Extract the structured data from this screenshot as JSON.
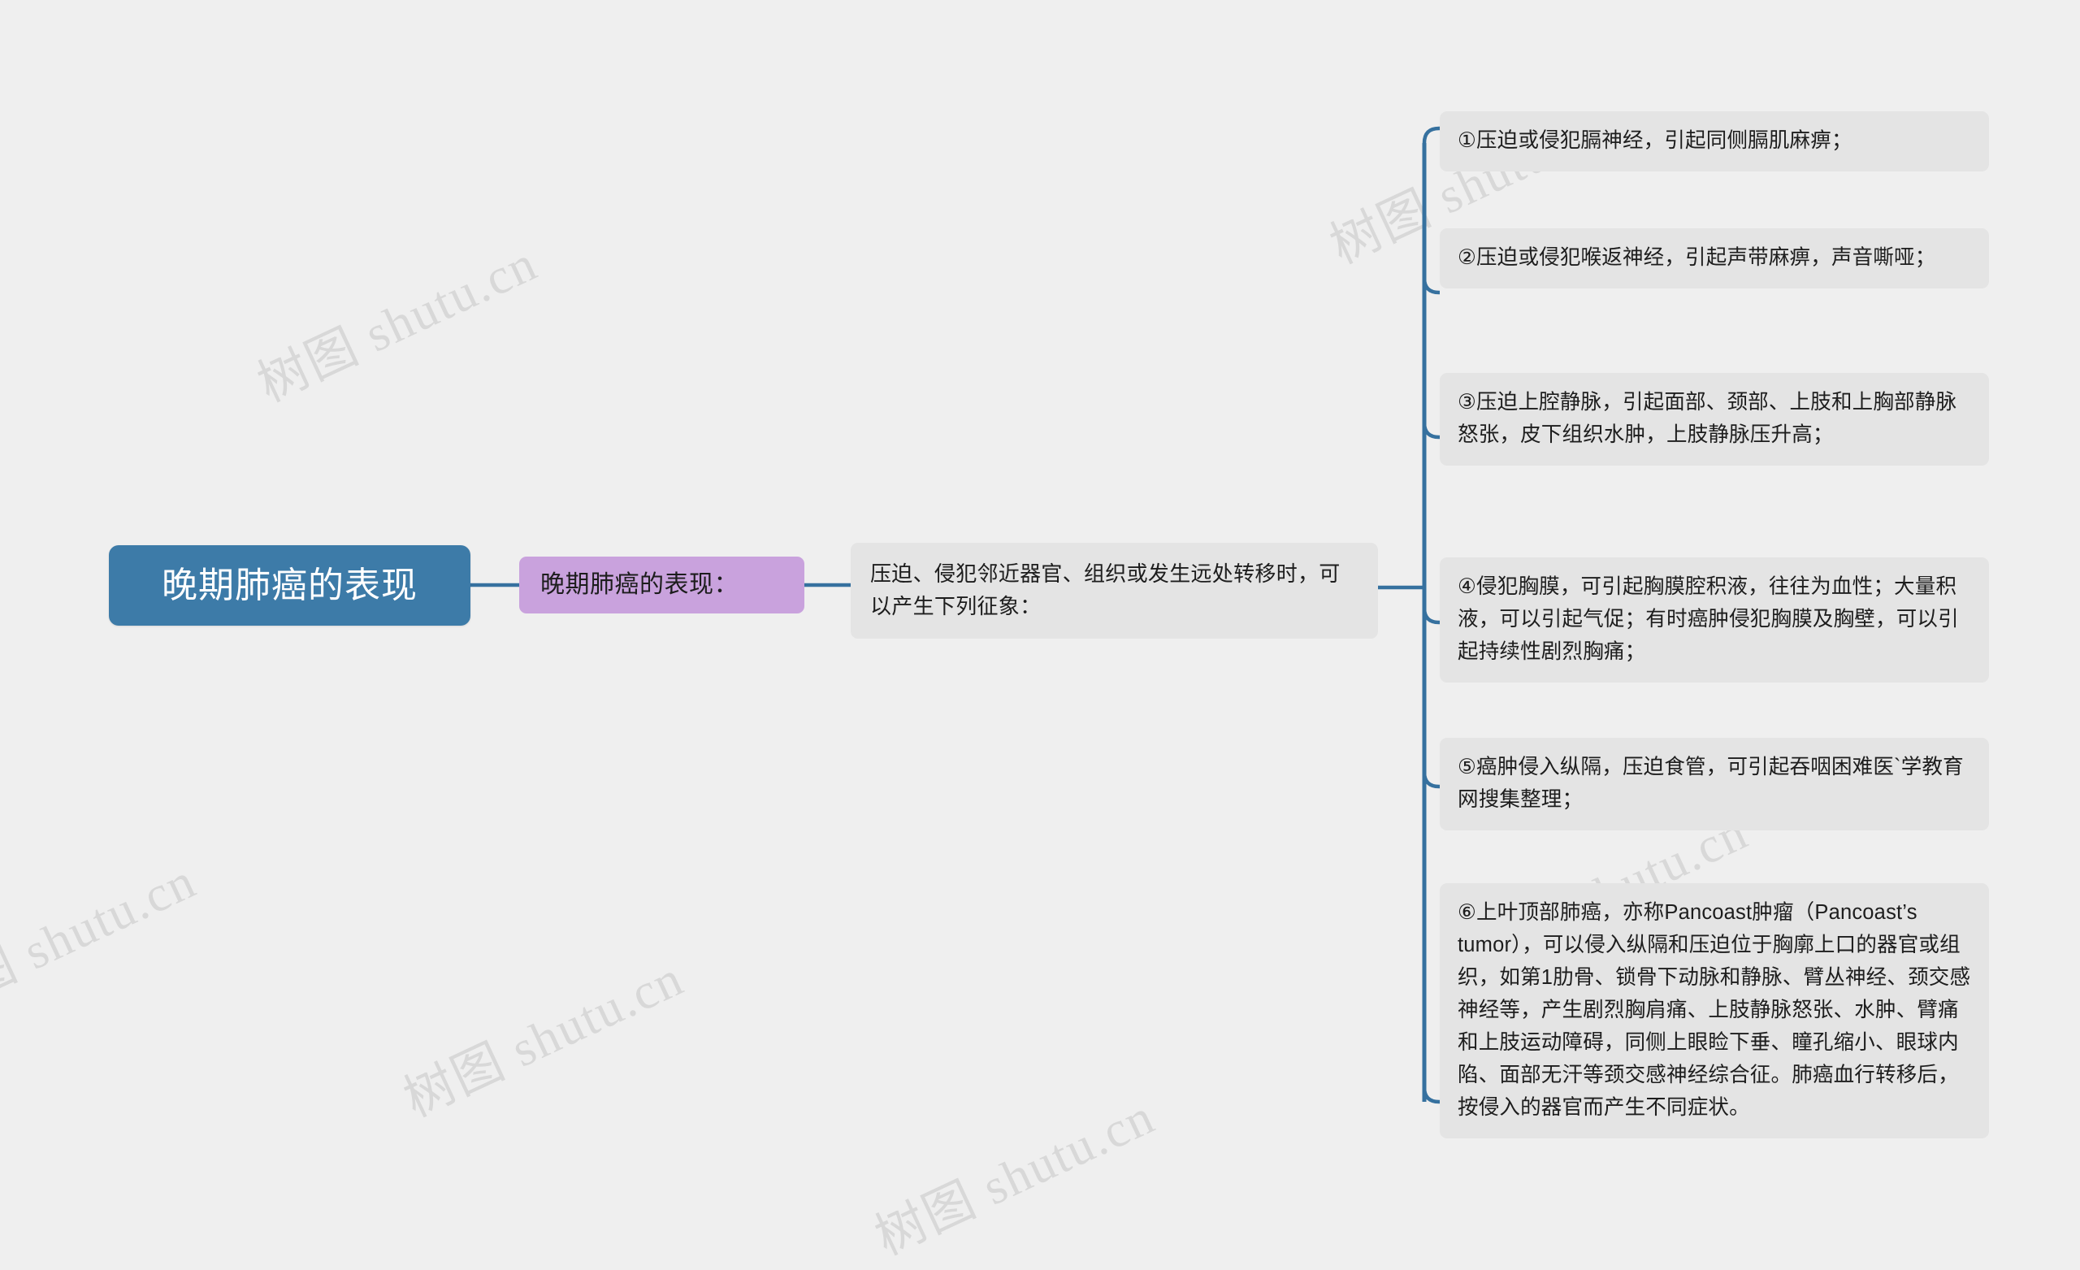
{
  "diagram": {
    "type": "mindmap",
    "title": "晚期肺癌的表现",
    "colors": {
      "root_bg": "#3d7ba8",
      "root_text": "#ffffff",
      "level1_bg": "#c9a2dd",
      "node_bg": "#e4e4e4",
      "node_text": "#1d1d1d",
      "edge": "#36719f",
      "canvas_bg": "#efefef",
      "watermark": "#d8d8d8"
    },
    "root": {
      "label": "晚期肺癌的表现"
    },
    "level1": {
      "label": "晚期肺癌的表现："
    },
    "level2": {
      "label": "压迫、侵犯邻近器官、组织或发生远处转移时，可以产生下列征象："
    },
    "leaves": [
      {
        "id": "leaf-1",
        "marker": "①",
        "label": "①压迫或侵犯膈神经，引起同侧膈肌麻痹；"
      },
      {
        "id": "leaf-2",
        "marker": "②",
        "label": "②压迫或侵犯喉返神经，引起声带麻痹，声音嘶哑；"
      },
      {
        "id": "leaf-3",
        "marker": "③",
        "label": "③压迫上腔静脉，引起面部、颈部、上肢和上胸部静脉怒张，皮下组织水肿，上肢静脉压升高；"
      },
      {
        "id": "leaf-4",
        "marker": "④",
        "label": "④侵犯胸膜，可引起胸膜腔积液，往往为血性；大量积液，可以引起气促；有时癌肿侵犯胸膜及胸壁，可以引起持续性剧烈胸痛；"
      },
      {
        "id": "leaf-5",
        "marker": "⑤",
        "label": "⑤癌肿侵入纵隔，压迫食管，可引起吞咽困难医`学教育网搜集整理；"
      },
      {
        "id": "leaf-6",
        "marker": "⑥",
        "label": "⑥上叶顶部肺癌，亦称Pancoast肿瘤（Pancoast’s tumor），可以侵入纵隔和压迫位于胸廓上口的器官或组织，如第1肋骨、锁骨下动脉和静脉、臂丛神经、颈交感神经等，产生剧烈胸肩痛、上肢静脉怒张、水肿、臂痛和上肢运动障碍，同侧上眼睑下垂、瞳孔缩小、眼球内陷、面部无汗等颈交感神经综合征。肺癌血行转移后，按侵入的器官而产生不同症状。"
      }
    ]
  },
  "watermark": {
    "text": "树图 shutu.cn"
  }
}
